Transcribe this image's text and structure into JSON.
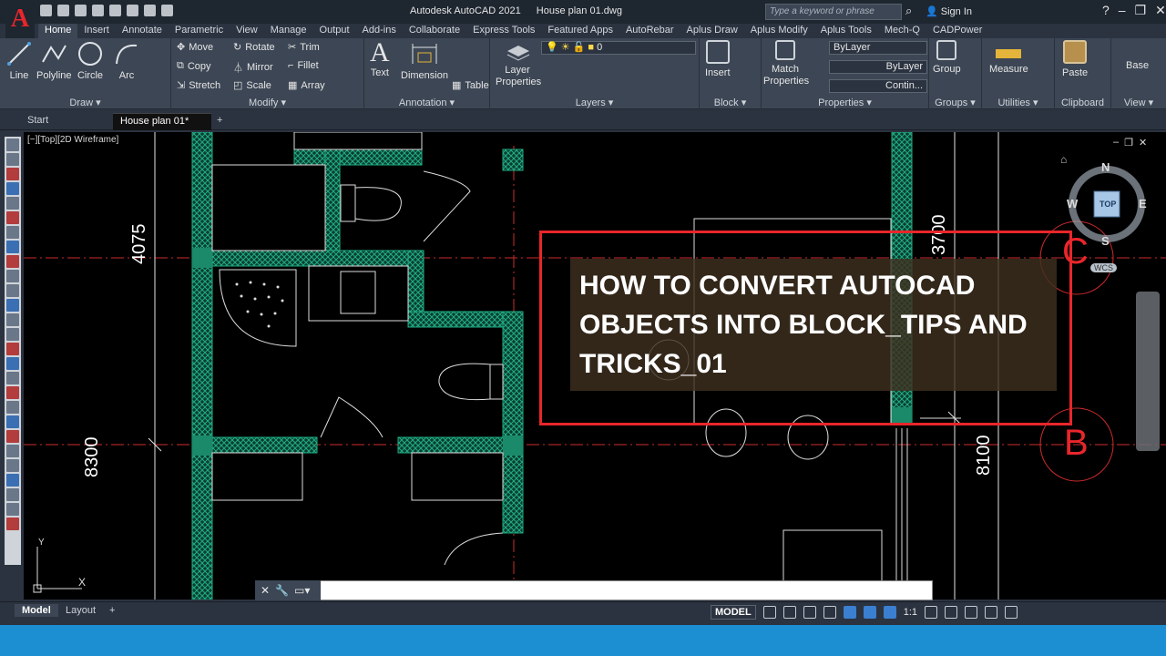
{
  "app": {
    "logo": "A",
    "title": "Autodesk AutoCAD 2021",
    "document": "House plan 01.dwg",
    "search_placeholder": "Type a keyword or phrase",
    "sign_in": "Sign In"
  },
  "ribbon_tabs": [
    "Home",
    "Insert",
    "Annotate",
    "Parametric",
    "View",
    "Manage",
    "Output",
    "Add-ins",
    "Collaborate",
    "Express Tools",
    "Featured Apps",
    "AutoRebar",
    "Aplus Draw",
    "Aplus Modify",
    "Aplus Tools",
    "Mech-Q",
    "CADPower"
  ],
  "panels": {
    "draw": {
      "title": "Draw ▾",
      "tools": [
        "Line",
        "Polyline",
        "Circle",
        "Arc"
      ]
    },
    "modify": {
      "title": "Modify ▾",
      "tools": [
        "Move",
        "Rotate",
        "Trim",
        "Copy",
        "Mirror",
        "Fillet",
        "Stretch",
        "Scale",
        "Array"
      ]
    },
    "annotation": {
      "title": "Annotation ▾",
      "tools": [
        "Text",
        "Dimension",
        "Table"
      ]
    },
    "layers": {
      "title": "Layers ▾",
      "layer_props": "Layer Properties",
      "current_layer": "0"
    },
    "block": {
      "title": "Block ▾",
      "insert": "Insert"
    },
    "properties": {
      "title": "Properties ▾",
      "match": "Match Properties",
      "color": "ByLayer",
      "linetype": "ByLayer",
      "lineweight": "Contin..."
    },
    "groups": {
      "title": "Groups ▾",
      "group": "Group"
    },
    "utilities": {
      "title": "Utilities ▾",
      "measure": "Measure"
    },
    "clipboard": {
      "title": "Clipboard",
      "paste": "Paste"
    },
    "view": {
      "title": "View ▾",
      "base": "Base"
    }
  },
  "doc_tabs": {
    "start": "Start",
    "active": "House plan 01*",
    "close": "✕",
    "add": "+"
  },
  "viewport_label": "[−][Top][2D Wireframe]",
  "drawing": {
    "dims": [
      "4075",
      "8300",
      "3700",
      "8100"
    ],
    "grid_markers": [
      "C",
      "B"
    ],
    "ucs": {
      "y": "Y",
      "x": "X"
    }
  },
  "viewcube": {
    "n": "N",
    "s": "S",
    "e": "E",
    "w": "W",
    "top": "TOP",
    "wcs": "WCS"
  },
  "overlay": {
    "headline": "HOW TO CONVERT AUTOCAD OBJECTS INTO BLOCK_TIPS AND TRICKS_01"
  },
  "layout_tabs": {
    "model": "Model",
    "layout": "Layout",
    "add": "+"
  },
  "status": {
    "model": "MODEL",
    "scale": "1:1"
  },
  "colors": {
    "accent": "#e8262b",
    "hatch": "#1a8a6a",
    "dim": "#ffffff",
    "grid": "#cc2b2b"
  }
}
